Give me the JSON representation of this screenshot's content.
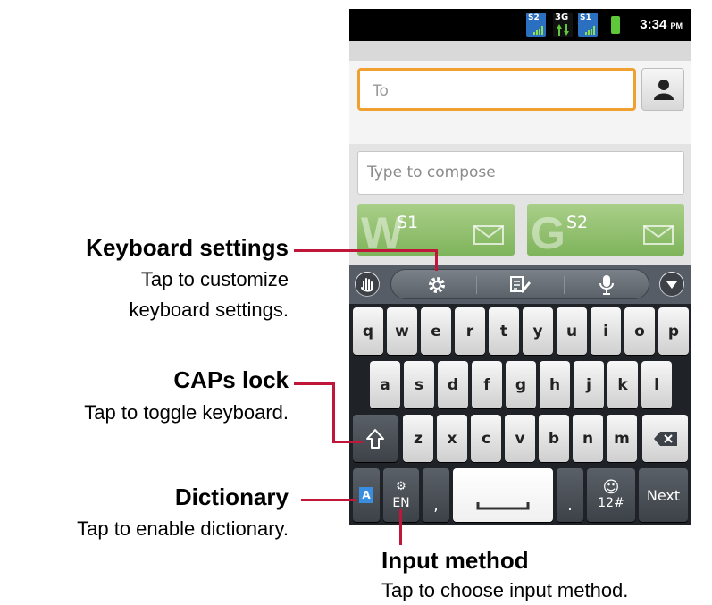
{
  "status_bar": {
    "sim1_label": "S2",
    "sim_3g_label": "3G",
    "sim2_label": "S1",
    "time": "3:34",
    "ampm": "PM"
  },
  "compose": {
    "to_placeholder": "To",
    "message_placeholder": "Type to compose",
    "send_buttons": [
      {
        "label": "S1",
        "letter": "W"
      },
      {
        "label": "S2",
        "letter": "G"
      }
    ]
  },
  "keyboard": {
    "row1": [
      "q",
      "w",
      "e",
      "r",
      "t",
      "y",
      "u",
      "i",
      "o",
      "p"
    ],
    "row2": [
      "a",
      "s",
      "d",
      "f",
      "g",
      "h",
      "j",
      "k",
      "l"
    ],
    "row3": [
      "z",
      "x",
      "c",
      "v",
      "b",
      "n",
      "m"
    ],
    "lang_label": "EN",
    "comma_label": ",",
    "period_label": ".",
    "sym_label": "12#",
    "next_label": "Next",
    "dict_label": "A"
  },
  "callouts": {
    "keyboard_settings": {
      "title": "Keyboard settings",
      "desc_line1": "Tap to customize",
      "desc_line2": "keyboard settings."
    },
    "caps_lock": {
      "title": "CAPs lock",
      "desc": "Tap to toggle keyboard."
    },
    "dictionary": {
      "title": "Dictionary",
      "desc": "Tap to enable dictionary."
    },
    "input_method": {
      "title": "Input method",
      "desc": "Tap to choose input method."
    }
  },
  "colors": {
    "accent_line": "#c0163a",
    "to_field_border": "#f0a030",
    "send_button_green": "#8fbf6a"
  }
}
